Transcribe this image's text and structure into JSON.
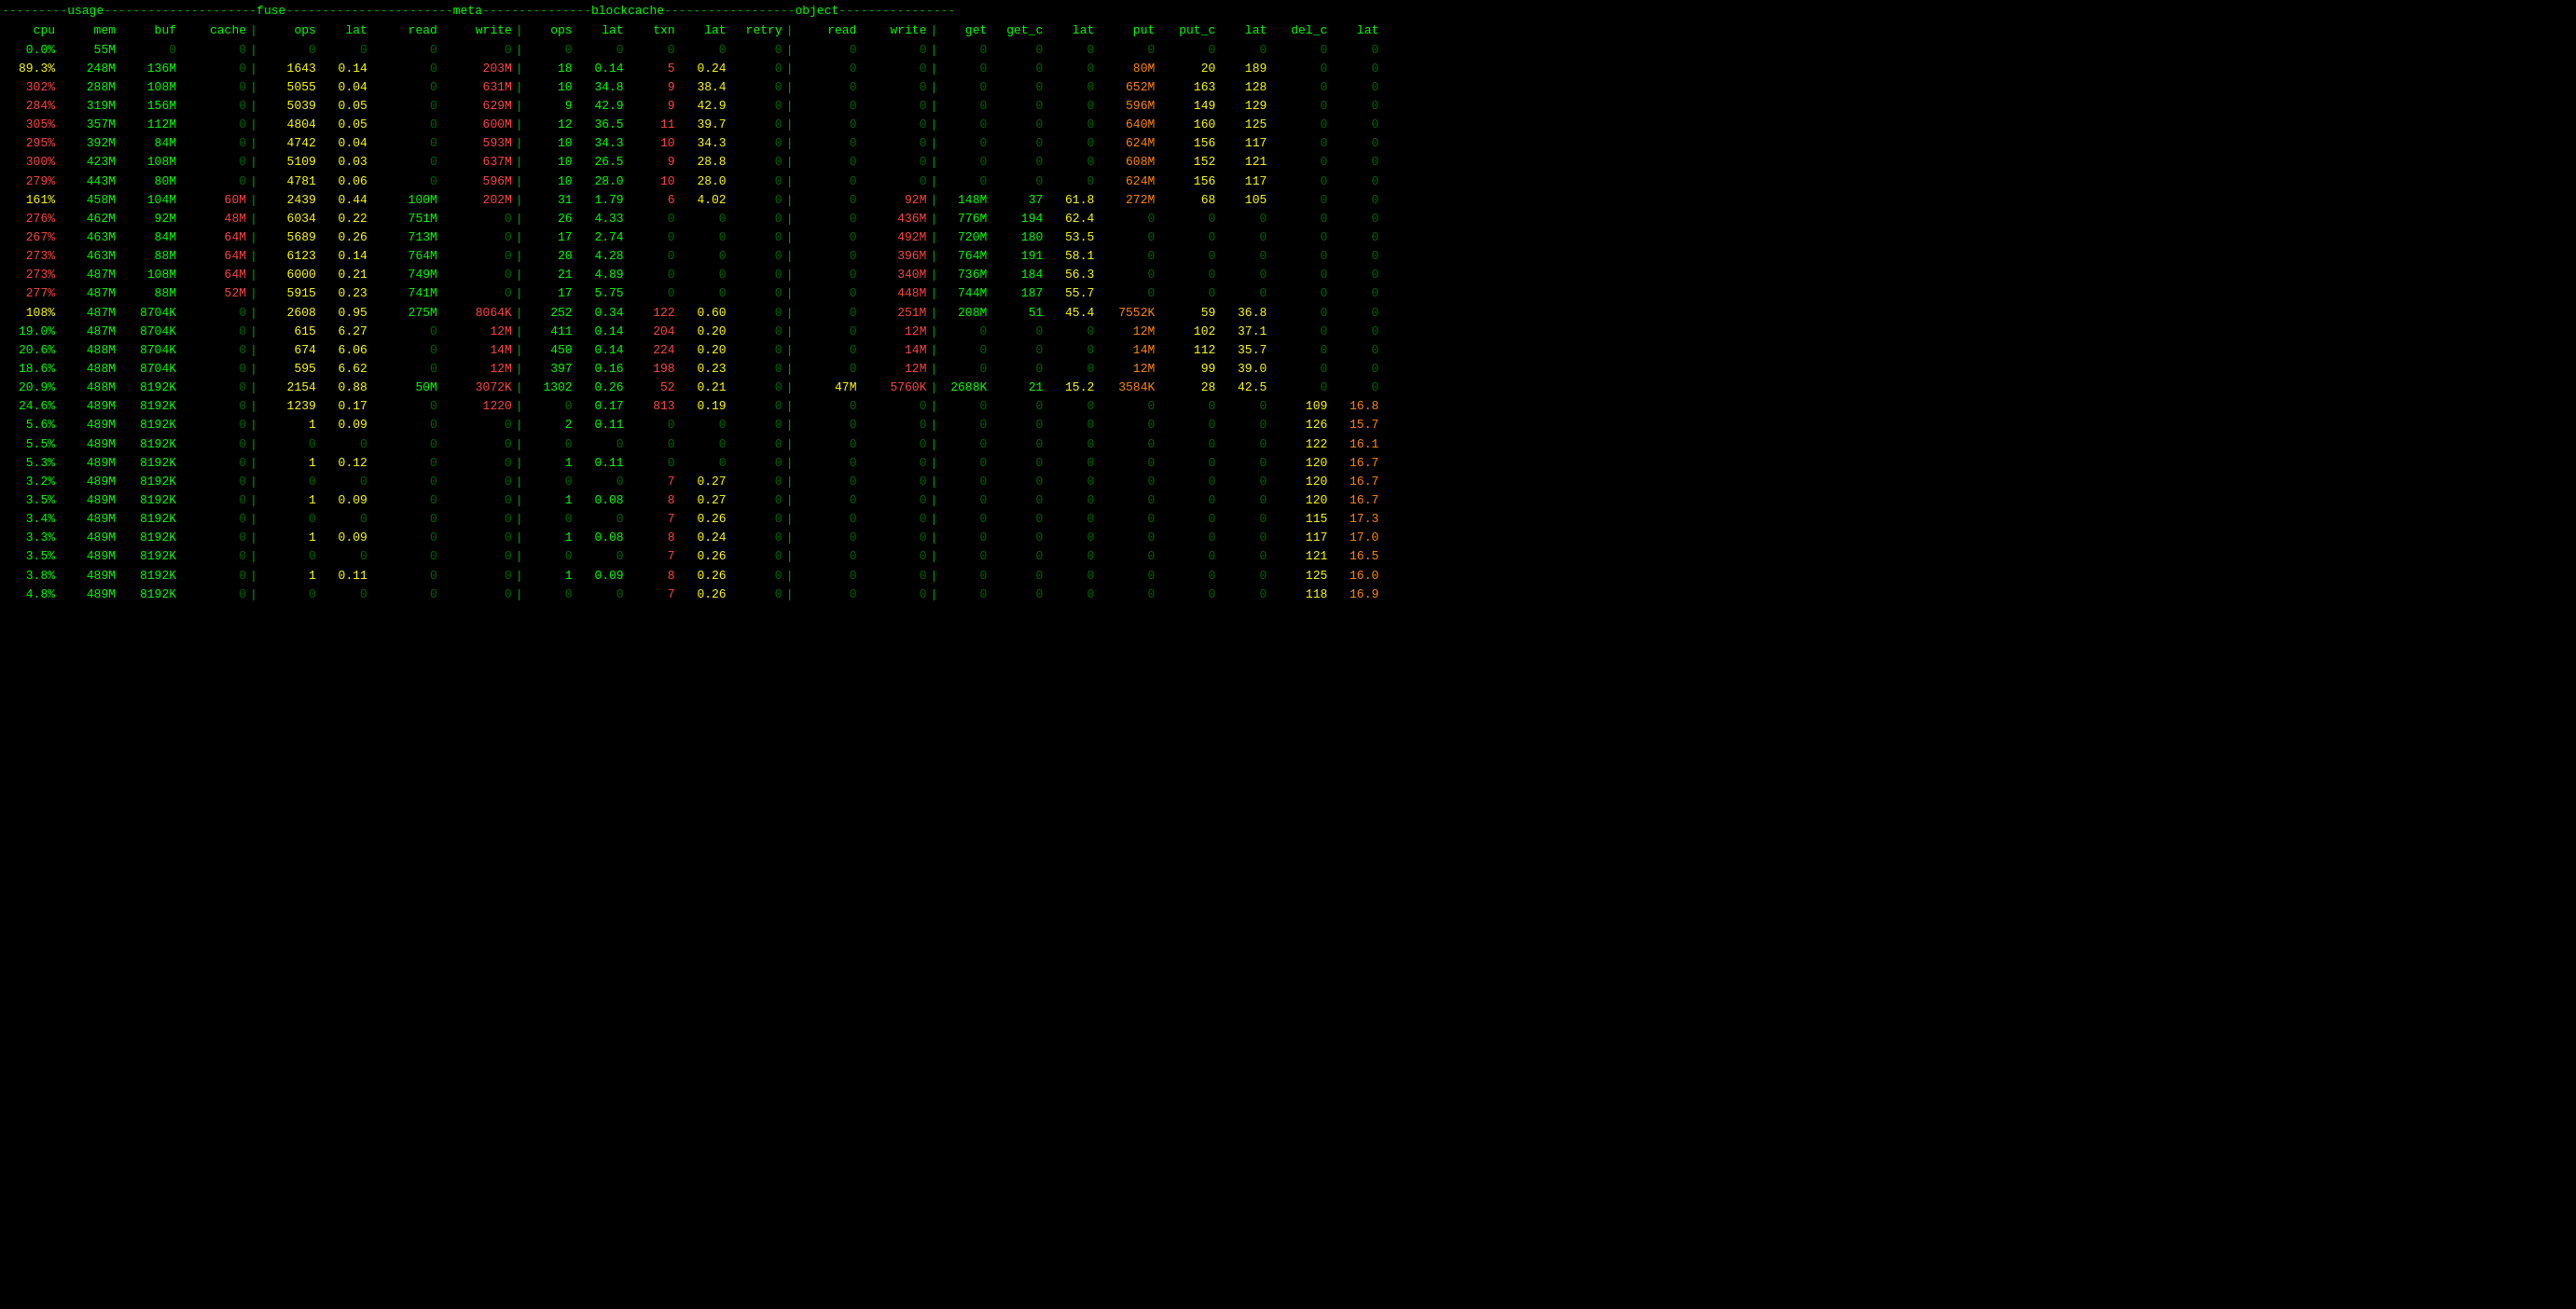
{
  "colors": {
    "green": "#00ff00",
    "yellow": "#ffff00",
    "red": "#ff4444",
    "cyan": "#00ffff",
    "white": "#ffffff",
    "orange": "#ff8800",
    "dim": "#006600"
  },
  "sections": {
    "usage": "usage",
    "fuse": "fuse",
    "meta": "meta",
    "blockcache": "blockcache",
    "object": "object"
  },
  "headers": {
    "cpu": "cpu",
    "mem": "mem",
    "buf": "buf",
    "cache": "cache",
    "fuse_ops": "ops",
    "fuse_lat": "lat",
    "fuse_read": "read",
    "fuse_write": "write",
    "meta_ops": "ops",
    "meta_lat": "lat",
    "meta_txn": "txn",
    "meta_tlat": "lat",
    "retry": "retry",
    "bc_read": "read",
    "bc_write": "write",
    "bc_get": "get",
    "bc_getc": "get_c",
    "bc_lat": "lat",
    "bc_put": "put",
    "bc_putc": "put_c",
    "bc_blat": "lat",
    "bc_delc": "del_c",
    "bc_dlat": "lat"
  },
  "rows": [
    {
      "cpu": "0.0%",
      "mem": "55M",
      "buf": "0",
      "cache": "0",
      "fops": "0",
      "flat": "0",
      "fread": "0",
      "fwrite": "0",
      "mops": "0",
      "mlat": "0",
      "txn": "0",
      "tlat": "0",
      "retry": "0",
      "bcread": "0",
      "bcwrite": "0",
      "get": "0",
      "getc": "0",
      "blat": "0",
      "put": "0",
      "putc": "0",
      "bblat": "0",
      "delc": "0",
      "dlat": "0",
      "cpu_c": "c-green",
      "mem_c": "c-green",
      "fops_c": "c-dim",
      "flat_c": "c-dim",
      "fwrite_c": "c-dim",
      "mops_c": "c-dim",
      "mlat_c": "c-dim",
      "txn_c": "c-dim",
      "tlat_c": "c-dim",
      "put_c_c": "c-dim",
      "putc_c": "c-dim",
      "delc_c": "c-dim",
      "dlat_c": "c-dim"
    },
    {
      "cpu": "89.3%",
      "mem": "248M",
      "buf": "136M",
      "cache": "0",
      "fops": "1643",
      "flat": "0.14",
      "fread": "0",
      "fwrite": "203M",
      "mops": "18",
      "mlat": "0.14",
      "txn": "5",
      "tlat": "0.24",
      "retry": "0",
      "bcread": "0",
      "bcwrite": "0",
      "get": "0",
      "getc": "0",
      "blat": "0",
      "put": "80M",
      "putc": "20",
      "bblat": "189",
      "delc": "0",
      "dlat": "0",
      "cpu_c": "c-yellow",
      "mem_c": "c-green"
    },
    {
      "cpu": "302%",
      "mem": "288M",
      "buf": "108M",
      "cache": "0",
      "fops": "5055",
      "flat": "0.04",
      "fread": "0",
      "fwrite": "631M",
      "mops": "10",
      "mlat": "34.8",
      "txn": "9",
      "tlat": "38.4",
      "retry": "0",
      "bcread": "0",
      "bcwrite": "0",
      "get": "0",
      "getc": "0",
      "blat": "0",
      "put": "652M",
      "putc": "163",
      "bblat": "128",
      "delc": "0",
      "dlat": "0",
      "cpu_c": "c-red"
    },
    {
      "cpu": "284%",
      "mem": "319M",
      "buf": "156M",
      "cache": "0",
      "fops": "5039",
      "flat": "0.05",
      "fread": "0",
      "fwrite": "629M",
      "mops": "9",
      "mlat": "42.9",
      "txn": "9",
      "tlat": "42.9",
      "retry": "0",
      "bcread": "0",
      "bcwrite": "0",
      "get": "0",
      "getc": "0",
      "blat": "0",
      "put": "596M",
      "putc": "149",
      "bblat": "129",
      "delc": "0",
      "dlat": "0",
      "cpu_c": "c-red"
    },
    {
      "cpu": "305%",
      "mem": "357M",
      "buf": "112M",
      "cache": "0",
      "fops": "4804",
      "flat": "0.05",
      "fread": "0",
      "fwrite": "600M",
      "mops": "12",
      "mlat": "36.5",
      "txn": "11",
      "tlat": "39.7",
      "retry": "0",
      "bcread": "0",
      "bcwrite": "0",
      "get": "0",
      "getc": "0",
      "blat": "0",
      "put": "640M",
      "putc": "160",
      "bblat": "125",
      "delc": "0",
      "dlat": "0",
      "cpu_c": "c-red"
    },
    {
      "cpu": "295%",
      "mem": "392M",
      "buf": "84M",
      "cache": "0",
      "fops": "4742",
      "flat": "0.04",
      "fread": "0",
      "fwrite": "593M",
      "mops": "10",
      "mlat": "34.3",
      "txn": "10",
      "tlat": "34.3",
      "retry": "0",
      "bcread": "0",
      "bcwrite": "0",
      "get": "0",
      "getc": "0",
      "blat": "0",
      "put": "624M",
      "putc": "156",
      "bblat": "117",
      "delc": "0",
      "dlat": "0",
      "cpu_c": "c-red"
    },
    {
      "cpu": "300%",
      "mem": "423M",
      "buf": "108M",
      "cache": "0",
      "fops": "5109",
      "flat": "0.03",
      "fread": "0",
      "fwrite": "637M",
      "mops": "10",
      "mlat": "26.5",
      "txn": "9",
      "tlat": "28.8",
      "retry": "0",
      "bcread": "0",
      "bcwrite": "0",
      "get": "0",
      "getc": "0",
      "blat": "0",
      "put": "608M",
      "putc": "152",
      "bblat": "121",
      "delc": "0",
      "dlat": "0",
      "cpu_c": "c-red"
    },
    {
      "cpu": "279%",
      "mem": "443M",
      "buf": "80M",
      "cache": "0",
      "fops": "4781",
      "flat": "0.06",
      "fread": "0",
      "fwrite": "596M",
      "mops": "10",
      "mlat": "28.0",
      "txn": "10",
      "tlat": "28.0",
      "retry": "0",
      "bcread": "0",
      "bcwrite": "0",
      "get": "0",
      "getc": "0",
      "blat": "0",
      "put": "624M",
      "putc": "156",
      "bblat": "117",
      "delc": "0",
      "dlat": "0",
      "cpu_c": "c-red"
    },
    {
      "cpu": "161%",
      "mem": "458M",
      "buf": "104M",
      "cache": "60M",
      "fops": "2439",
      "flat": "0.44",
      "fread": "100M",
      "fwrite": "202M",
      "mops": "31",
      "mlat": "1.79",
      "txn": "6",
      "tlat": "4.02",
      "retry": "0",
      "bcread": "0",
      "bcwrite": "92M",
      "get": "148M",
      "getc": "37",
      "blat": "61.8",
      "put": "272M",
      "putc": "68",
      "bblat": "105",
      "delc": "0",
      "dlat": "0",
      "cpu_c": "c-yellow"
    },
    {
      "cpu": "276%",
      "mem": "462M",
      "buf": "92M",
      "cache": "48M",
      "fops": "6034",
      "flat": "0.22",
      "fread": "751M",
      "fwrite": "0",
      "mops": "26",
      "mlat": "4.33",
      "txn": "0",
      "tlat": "0",
      "retry": "0",
      "bcread": "0",
      "bcwrite": "436M",
      "get": "776M",
      "getc": "194",
      "blat": "62.4",
      "put": "0",
      "putc": "0",
      "bblat": "0",
      "delc": "0",
      "dlat": "0",
      "cpu_c": "c-red"
    },
    {
      "cpu": "267%",
      "mem": "463M",
      "buf": "84M",
      "cache": "64M",
      "fops": "5689",
      "flat": "0.26",
      "fread": "713M",
      "fwrite": "0",
      "mops": "17",
      "mlat": "2.74",
      "txn": "0",
      "tlat": "0",
      "retry": "0",
      "bcread": "0",
      "bcwrite": "492M",
      "get": "720M",
      "getc": "180",
      "blat": "53.5",
      "put": "0",
      "putc": "0",
      "bblat": "0",
      "delc": "0",
      "dlat": "0",
      "cpu_c": "c-red"
    },
    {
      "cpu": "273%",
      "mem": "463M",
      "buf": "88M",
      "cache": "64M",
      "fops": "6123",
      "flat": "0.14",
      "fread": "764M",
      "fwrite": "0",
      "mops": "20",
      "mlat": "4.28",
      "txn": "0",
      "tlat": "0",
      "retry": "0",
      "bcread": "0",
      "bcwrite": "396M",
      "get": "764M",
      "getc": "191",
      "blat": "58.1",
      "put": "0",
      "putc": "0",
      "bblat": "0",
      "delc": "0",
      "dlat": "0",
      "cpu_c": "c-red"
    },
    {
      "cpu": "273%",
      "mem": "487M",
      "buf": "108M",
      "cache": "64M",
      "fops": "6000",
      "flat": "0.21",
      "fread": "749M",
      "fwrite": "0",
      "mops": "21",
      "mlat": "4.89",
      "txn": "0",
      "tlat": "0",
      "retry": "0",
      "bcread": "0",
      "bcwrite": "340M",
      "get": "736M",
      "getc": "184",
      "blat": "56.3",
      "put": "0",
      "putc": "0",
      "bblat": "0",
      "delc": "0",
      "dlat": "0",
      "cpu_c": "c-red"
    },
    {
      "cpu": "277%",
      "mem": "487M",
      "buf": "88M",
      "cache": "52M",
      "fops": "5915",
      "flat": "0.23",
      "fread": "741M",
      "fwrite": "0",
      "mops": "17",
      "mlat": "5.75",
      "txn": "0",
      "tlat": "0",
      "retry": "0",
      "bcread": "0",
      "bcwrite": "448M",
      "get": "744M",
      "getc": "187",
      "blat": "55.7",
      "put": "0",
      "putc": "0",
      "bblat": "0",
      "delc": "0",
      "dlat": "0",
      "cpu_c": "c-red"
    },
    {
      "cpu": "108%",
      "mem": "487M",
      "buf": "8704K",
      "cache": "0",
      "fops": "2608",
      "flat": "0.95",
      "fread": "275M",
      "fwrite": "8064K",
      "mops": "252",
      "mlat": "0.34",
      "txn": "122",
      "tlat": "0.60",
      "retry": "0",
      "bcread": "0",
      "bcwrite": "251M",
      "get": "208M",
      "getc": "51",
      "blat": "45.4",
      "put": "7552K",
      "putc": "59",
      "bblat": "36.8",
      "delc": "0",
      "dlat": "0",
      "cpu_c": "c-yellow"
    },
    {
      "cpu": "19.0%",
      "mem": "487M",
      "buf": "8704K",
      "cache": "0",
      "fops": "615",
      "flat": "6.27",
      "fread": "0",
      "fwrite": "12M",
      "mops": "411",
      "mlat": "0.14",
      "txn": "204",
      "tlat": "0.20",
      "retry": "0",
      "bcread": "0",
      "bcwrite": "12M",
      "get": "0",
      "getc": "0",
      "blat": "0",
      "put": "12M",
      "putc": "102",
      "bblat": "37.1",
      "delc": "0",
      "dlat": "0",
      "cpu_c": "c-green"
    },
    {
      "cpu": "20.6%",
      "mem": "488M",
      "buf": "8704K",
      "cache": "0",
      "fops": "674",
      "flat": "6.06",
      "fread": "0",
      "fwrite": "14M",
      "mops": "450",
      "mlat": "0.14",
      "txn": "224",
      "tlat": "0.20",
      "retry": "0",
      "bcread": "0",
      "bcwrite": "14M",
      "get": "0",
      "getc": "0",
      "blat": "0",
      "put": "14M",
      "putc": "112",
      "bblat": "35.7",
      "delc": "0",
      "dlat": "0",
      "cpu_c": "c-green"
    },
    {
      "cpu": "18.6%",
      "mem": "488M",
      "buf": "8704K",
      "cache": "0",
      "fops": "595",
      "flat": "6.62",
      "fread": "0",
      "fwrite": "12M",
      "mops": "397",
      "mlat": "0.16",
      "txn": "198",
      "tlat": "0.23",
      "retry": "0",
      "bcread": "0",
      "bcwrite": "12M",
      "get": "0",
      "getc": "0",
      "blat": "0",
      "put": "12M",
      "putc": "99",
      "bblat": "39.0",
      "delc": "0",
      "dlat": "0",
      "cpu_c": "c-green"
    },
    {
      "cpu": "20.9%",
      "mem": "488M",
      "buf": "8192K",
      "cache": "0",
      "fops": "2154",
      "flat": "0.88",
      "fread": "50M",
      "fwrite": "3072K",
      "mops": "1302",
      "mlat": "0.26",
      "txn": "52",
      "tlat": "0.21",
      "retry": "0",
      "bcread": "47M",
      "bcwrite": "5760K",
      "get": "2688K",
      "getc": "21",
      "blat": "15.2",
      "put": "3584K",
      "putc": "28",
      "bblat": "42.5",
      "delc": "0",
      "dlat": "0",
      "cpu_c": "c-green"
    },
    {
      "cpu": "24.6%",
      "mem": "489M",
      "buf": "8192K",
      "cache": "0",
      "fops": "1239",
      "flat": "0.17",
      "fread": "0",
      "fwrite": "1220",
      "mops": "0",
      "mlat": "0.17",
      "txn": "813",
      "tlat": "0.19",
      "retry": "0",
      "bcread": "0",
      "bcwrite": "0",
      "get": "0",
      "getc": "0",
      "blat": "0",
      "put": "0",
      "putc": "0",
      "bblat": "0",
      "delc": "109",
      "dlat": "16.8",
      "cpu_c": "c-green"
    },
    {
      "cpu": "5.6%",
      "mem": "489M",
      "buf": "8192K",
      "cache": "0",
      "fops": "1",
      "flat": "0.09",
      "fread": "0",
      "fwrite": "0",
      "mops": "2",
      "mlat": "0.11",
      "txn": "0",
      "tlat": "0",
      "retry": "0",
      "bcread": "0",
      "bcwrite": "0",
      "get": "0",
      "getc": "0",
      "blat": "0",
      "put": "0",
      "putc": "0",
      "bblat": "0",
      "delc": "126",
      "dlat": "15.7",
      "cpu_c": "c-green"
    },
    {
      "cpu": "5.5%",
      "mem": "489M",
      "buf": "8192K",
      "cache": "0",
      "fops": "0",
      "flat": "0",
      "fread": "0",
      "fwrite": "0",
      "mops": "0",
      "mlat": "0",
      "txn": "0",
      "tlat": "0",
      "retry": "0",
      "bcread": "0",
      "bcwrite": "0",
      "get": "0",
      "getc": "0",
      "blat": "0",
      "put": "0",
      "putc": "0",
      "bblat": "0",
      "delc": "122",
      "dlat": "16.1",
      "cpu_c": "c-green"
    },
    {
      "cpu": "5.3%",
      "mem": "489M",
      "buf": "8192K",
      "cache": "0",
      "fops": "1",
      "flat": "0.12",
      "fread": "0",
      "fwrite": "0",
      "mops": "1",
      "mlat": "0.11",
      "txn": "0",
      "tlat": "0",
      "retry": "0",
      "bcread": "0",
      "bcwrite": "0",
      "get": "0",
      "getc": "0",
      "blat": "0",
      "put": "0",
      "putc": "0",
      "bblat": "0",
      "delc": "120",
      "dlat": "16.7",
      "cpu_c": "c-green"
    },
    {
      "cpu": "3.2%",
      "mem": "489M",
      "buf": "8192K",
      "cache": "0",
      "fops": "0",
      "flat": "0",
      "fread": "0",
      "fwrite": "0",
      "mops": "0",
      "mlat": "0",
      "txn": "7",
      "tlat": "0.27",
      "retry": "0",
      "bcread": "0",
      "bcwrite": "0",
      "get": "0",
      "getc": "0",
      "blat": "0",
      "put": "0",
      "putc": "0",
      "bblat": "0",
      "delc": "120",
      "dlat": "16.7",
      "cpu_c": "c-green"
    },
    {
      "cpu": "3.5%",
      "mem": "489M",
      "buf": "8192K",
      "cache": "0",
      "fops": "1",
      "flat": "0.09",
      "fread": "0",
      "fwrite": "0",
      "mops": "1",
      "mlat": "0.08",
      "txn": "8",
      "tlat": "0.27",
      "retry": "0",
      "bcread": "0",
      "bcwrite": "0",
      "get": "0",
      "getc": "0",
      "blat": "0",
      "put": "0",
      "putc": "0",
      "bblat": "0",
      "delc": "120",
      "dlat": "16.7",
      "cpu_c": "c-green"
    },
    {
      "cpu": "3.4%",
      "mem": "489M",
      "buf": "8192K",
      "cache": "0",
      "fops": "0",
      "flat": "0",
      "fread": "0",
      "fwrite": "0",
      "mops": "0",
      "mlat": "0",
      "txn": "7",
      "tlat": "0.26",
      "retry": "0",
      "bcread": "0",
      "bcwrite": "0",
      "get": "0",
      "getc": "0",
      "blat": "0",
      "put": "0",
      "putc": "0",
      "bblat": "0",
      "delc": "115",
      "dlat": "17.3",
      "cpu_c": "c-green"
    },
    {
      "cpu": "3.3%",
      "mem": "489M",
      "buf": "8192K",
      "cache": "0",
      "fops": "1",
      "flat": "0.09",
      "fread": "0",
      "fwrite": "0",
      "mops": "1",
      "mlat": "0.08",
      "txn": "8",
      "tlat": "0.24",
      "retry": "0",
      "bcread": "0",
      "bcwrite": "0",
      "get": "0",
      "getc": "0",
      "blat": "0",
      "put": "0",
      "putc": "0",
      "bblat": "0",
      "delc": "117",
      "dlat": "17.0",
      "cpu_c": "c-green"
    },
    {
      "cpu": "3.5%",
      "mem": "489M",
      "buf": "8192K",
      "cache": "0",
      "fops": "0",
      "flat": "0",
      "fread": "0",
      "fwrite": "0",
      "mops": "0",
      "mlat": "0",
      "txn": "7",
      "tlat": "0.26",
      "retry": "0",
      "bcread": "0",
      "bcwrite": "0",
      "get": "0",
      "getc": "0",
      "blat": "0",
      "put": "0",
      "putc": "0",
      "bblat": "0",
      "delc": "121",
      "dlat": "16.5",
      "cpu_c": "c-green"
    },
    {
      "cpu": "3.8%",
      "mem": "489M",
      "buf": "8192K",
      "cache": "0",
      "fops": "1",
      "flat": "0.11",
      "fread": "0",
      "fwrite": "0",
      "mops": "1",
      "mlat": "0.09",
      "txn": "8",
      "tlat": "0.26",
      "retry": "0",
      "bcread": "0",
      "bcwrite": "0",
      "get": "0",
      "getc": "0",
      "blat": "0",
      "put": "0",
      "putc": "0",
      "bblat": "0",
      "delc": "125",
      "dlat": "16.0",
      "cpu_c": "c-green"
    },
    {
      "cpu": "4.8%",
      "mem": "489M",
      "buf": "8192K",
      "cache": "0",
      "fops": "0",
      "flat": "0",
      "fread": "0",
      "fwrite": "0",
      "mops": "0",
      "mlat": "0",
      "txn": "7",
      "tlat": "0.26",
      "retry": "0",
      "bcread": "0",
      "bcwrite": "0",
      "get": "0",
      "getc": "0",
      "blat": "0",
      "put": "0",
      "putc": "0",
      "bblat": "0",
      "delc": "118",
      "dlat": "16.9",
      "cpu_c": "c-green"
    }
  ]
}
